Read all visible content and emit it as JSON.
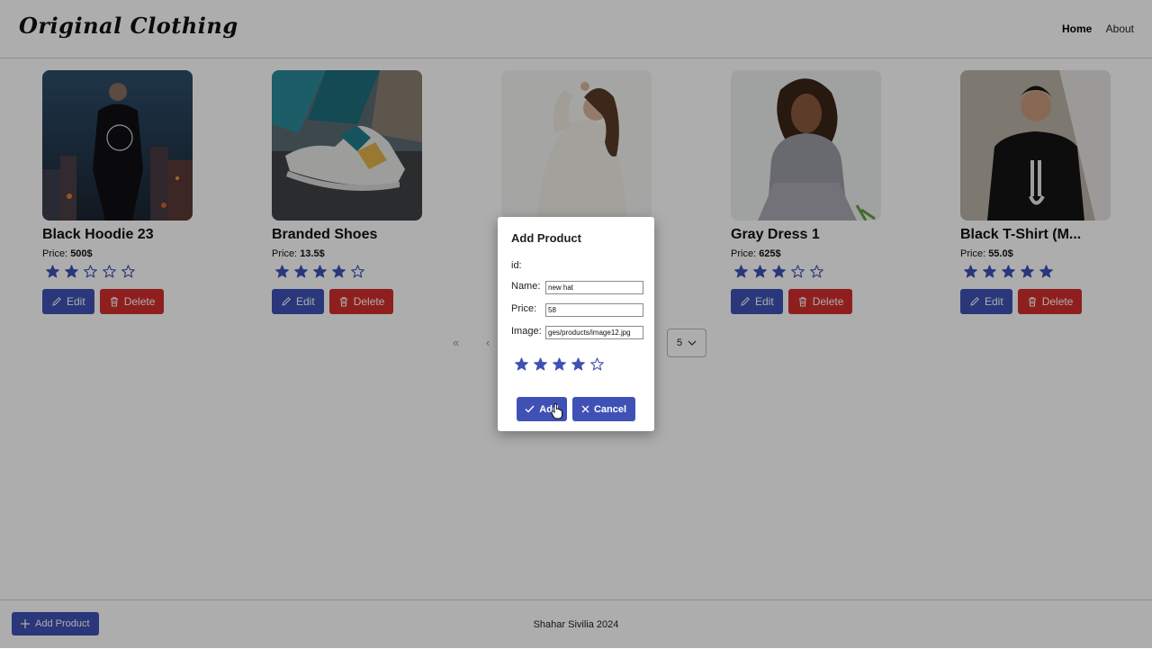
{
  "header": {
    "brand": "Original Clothing",
    "nav": {
      "home": "Home",
      "about": "About"
    }
  },
  "products": [
    {
      "title": "Black Hoodie 23",
      "price_label": "Price:",
      "price": "500$",
      "rating": 2,
      "edit_label": "Edit",
      "delete_label": "Delete",
      "image": "black-hoodie-photo"
    },
    {
      "title": "Branded Shoes",
      "price_label": "Price:",
      "price": "13.5$",
      "rating": 4,
      "edit_label": "Edit",
      "delete_label": "Delete",
      "image": "sneaker-photo"
    },
    {
      "title": "",
      "price_label": "",
      "price": "",
      "rating": 0,
      "edit_label": "",
      "delete_label": "",
      "image": "white-sweater-photo"
    },
    {
      "title": "Gray Dress 1",
      "price_label": "Price:",
      "price": "625$",
      "rating": 3,
      "edit_label": "Edit",
      "delete_label": "Delete",
      "image": "gray-dress-photo"
    },
    {
      "title": "Black T-Shirt (M...",
      "price_label": "Price:",
      "price": "55.0$",
      "rating": 5,
      "edit_label": "Edit",
      "delete_label": "Delete",
      "image": "black-tshirt-photo"
    }
  ],
  "pagination": {
    "first": "«",
    "prev": "‹",
    "page_size": "5"
  },
  "dialog": {
    "title": "Add Product",
    "id_label": "id:",
    "name_label": "Name:",
    "name_value": "new hat",
    "price_label": "Price:",
    "price_value": "58",
    "image_label": "Image:",
    "image_value": "ges/products/image12.jpg",
    "rating": 4,
    "add_label": "Add",
    "cancel_label": "Cancel"
  },
  "footer": {
    "text": "Shahar Sivilia 2024",
    "add_product_label": "Add Product"
  },
  "colors": {
    "primary": "#3f51b5",
    "danger": "#d32f2f",
    "star": "#3f51b5"
  }
}
